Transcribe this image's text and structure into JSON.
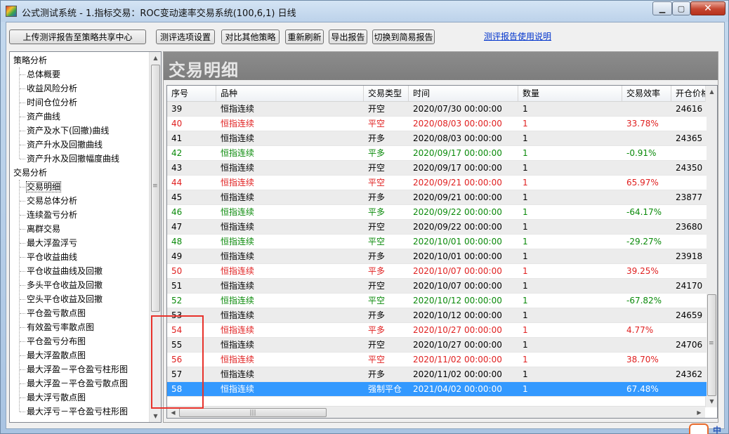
{
  "window": {
    "title": "公式测试系统 - 1.指标交易：ROC变动速率交易系统(100,6,1) 日线",
    "buttons": {
      "minimize": "▁",
      "maximize": "▢",
      "close": "✕"
    }
  },
  "toolbar": {
    "upload_label": "上传测评报告至策略共享中心",
    "options_label": "测评选项设置",
    "compare_label": "对比其他策略",
    "refresh_label": "重新刷新",
    "export_label": "导出报告",
    "switch_label": "切换到简易报告",
    "help_link": "测评报告使用说明"
  },
  "tree": {
    "groups": [
      {
        "label": "策略分析",
        "items": [
          "总体概要",
          "收益风险分析",
          "时间仓位分析",
          "资产曲线",
          "资产及水下(回撤)曲线",
          "资产升水及回撤曲线",
          "资产升水及回撤幅度曲线"
        ]
      },
      {
        "label": "交易分析",
        "items": [
          "交易明细",
          "交易总体分析",
          "连续盈亏分析",
          "离群交易",
          "最大浮盈浮亏",
          "平仓收益曲线",
          "平仓收益曲线及回撤",
          "多头平仓收益及回撤",
          "空头平仓收益及回撤",
          "平仓盈亏散点图",
          "有效盈亏率散点图",
          "平仓盈亏分布图",
          "最大浮盈散点图",
          "最大浮盈－平仓盈亏柱形图",
          "最大浮盈－平仓盈亏散点图",
          "最大浮亏散点图",
          "最大浮亏－平仓盈亏柱形图"
        ]
      }
    ],
    "selected": "交易明细"
  },
  "panel": {
    "title": "交易明细"
  },
  "table": {
    "columns": [
      "序号",
      "品种",
      "交易类型",
      "时间",
      "数量",
      "交易效率",
      "开仓价格"
    ],
    "rows": [
      {
        "no": "39",
        "symbol": "恒指连续",
        "type": "开空",
        "time": "2020/07/30 00:00:00",
        "qty": "1",
        "eff": "",
        "price": "24616",
        "color": "black"
      },
      {
        "no": "40",
        "symbol": "恒指连续",
        "type": "平空",
        "time": "2020/08/03 00:00:00",
        "qty": "1",
        "eff": "33.78%",
        "price": "",
        "color": "red"
      },
      {
        "no": "41",
        "symbol": "恒指连续",
        "type": "开多",
        "time": "2020/08/03 00:00:00",
        "qty": "1",
        "eff": "",
        "price": "24365",
        "color": "black"
      },
      {
        "no": "42",
        "symbol": "恒指连续",
        "type": "平多",
        "time": "2020/09/17 00:00:00",
        "qty": "1",
        "eff": "-0.91%",
        "price": "",
        "color": "green"
      },
      {
        "no": "43",
        "symbol": "恒指连续",
        "type": "开空",
        "time": "2020/09/17 00:00:00",
        "qty": "1",
        "eff": "",
        "price": "24350",
        "color": "black"
      },
      {
        "no": "44",
        "symbol": "恒指连续",
        "type": "平空",
        "time": "2020/09/21 00:00:00",
        "qty": "1",
        "eff": "65.97%",
        "price": "",
        "color": "red"
      },
      {
        "no": "45",
        "symbol": "恒指连续",
        "type": "开多",
        "time": "2020/09/21 00:00:00",
        "qty": "1",
        "eff": "",
        "price": "23877",
        "color": "black"
      },
      {
        "no": "46",
        "symbol": "恒指连续",
        "type": "平多",
        "time": "2020/09/22 00:00:00",
        "qty": "1",
        "eff": "-64.17%",
        "price": "",
        "color": "green"
      },
      {
        "no": "47",
        "symbol": "恒指连续",
        "type": "开空",
        "time": "2020/09/22 00:00:00",
        "qty": "1",
        "eff": "",
        "price": "23680",
        "color": "black"
      },
      {
        "no": "48",
        "symbol": "恒指连续",
        "type": "平空",
        "time": "2020/10/01 00:00:00",
        "qty": "1",
        "eff": "-29.27%",
        "price": "",
        "color": "green"
      },
      {
        "no": "49",
        "symbol": "恒指连续",
        "type": "开多",
        "time": "2020/10/01 00:00:00",
        "qty": "1",
        "eff": "",
        "price": "23918",
        "color": "black"
      },
      {
        "no": "50",
        "symbol": "恒指连续",
        "type": "平多",
        "time": "2020/10/07 00:00:00",
        "qty": "1",
        "eff": "39.25%",
        "price": "",
        "color": "red"
      },
      {
        "no": "51",
        "symbol": "恒指连续",
        "type": "开空",
        "time": "2020/10/07 00:00:00",
        "qty": "1",
        "eff": "",
        "price": "24170",
        "color": "black"
      },
      {
        "no": "52",
        "symbol": "恒指连续",
        "type": "平空",
        "time": "2020/10/12 00:00:00",
        "qty": "1",
        "eff": "-67.82%",
        "price": "",
        "color": "green"
      },
      {
        "no": "53",
        "symbol": "恒指连续",
        "type": "开多",
        "time": "2020/10/12 00:00:00",
        "qty": "1",
        "eff": "",
        "price": "24659",
        "color": "black"
      },
      {
        "no": "54",
        "symbol": "恒指连续",
        "type": "平多",
        "time": "2020/10/27 00:00:00",
        "qty": "1",
        "eff": "4.77%",
        "price": "",
        "color": "red"
      },
      {
        "no": "55",
        "symbol": "恒指连续",
        "type": "开空",
        "time": "2020/10/27 00:00:00",
        "qty": "1",
        "eff": "",
        "price": "24706",
        "color": "black"
      },
      {
        "no": "56",
        "symbol": "恒指连续",
        "type": "平空",
        "time": "2020/11/02 00:00:00",
        "qty": "1",
        "eff": "38.70%",
        "price": "",
        "color": "red"
      },
      {
        "no": "57",
        "symbol": "恒指连续",
        "type": "开多",
        "time": "2020/11/02 00:00:00",
        "qty": "1",
        "eff": "",
        "price": "24362",
        "color": "black"
      },
      {
        "no": "58",
        "symbol": "恒指连续",
        "type": "强制平仓",
        "time": "2021/04/02 00:00:00",
        "qty": "1",
        "eff": "67.48%",
        "price": "",
        "color": "selected"
      }
    ]
  },
  "tray": {
    "text": "中"
  }
}
